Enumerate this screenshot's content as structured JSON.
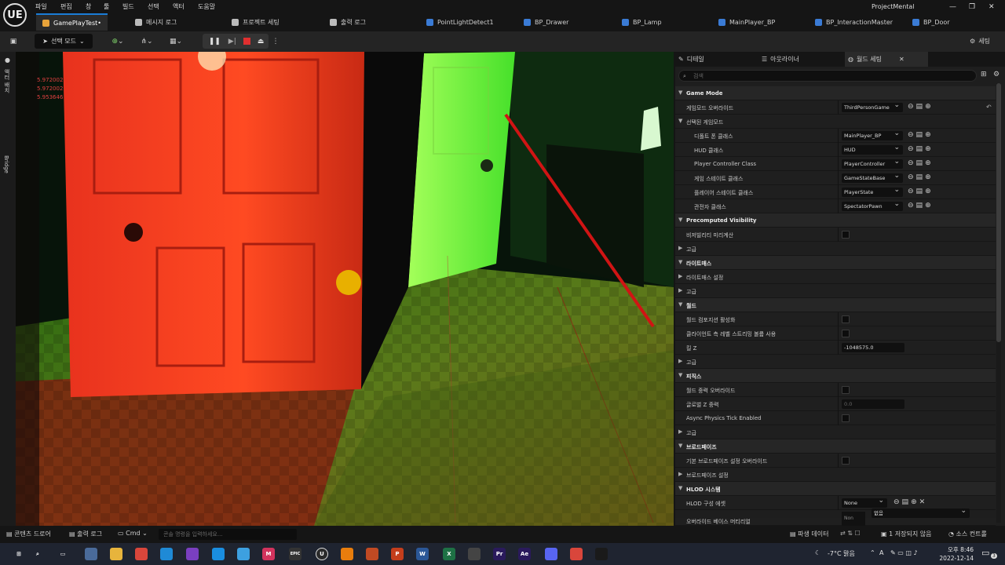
{
  "app": {
    "logo": "UE",
    "project_name": "ProjectMental"
  },
  "menu": [
    "파일",
    "편집",
    "창",
    "툴",
    "빌드",
    "선택",
    "액터",
    "도움말"
  ],
  "window_controls": [
    "—",
    "❐",
    "✕"
  ],
  "tabs": [
    {
      "label": "GamePlayTest•",
      "icon_color": "#e8a33a"
    },
    {
      "label": "메시지 로그",
      "icon_color": "#bbbbbb"
    },
    {
      "label": "프로젝트 세팅",
      "icon_color": "#bbbbbb"
    },
    {
      "label": "출력 로그",
      "icon_color": "#bbbbbb"
    },
    {
      "label": "PointLightDetect1",
      "icon_color": "#3a7bd5"
    },
    {
      "label": "BP_Drawer",
      "icon_color": "#3a7bd5"
    },
    {
      "label": "BP_Lamp",
      "icon_color": "#3a7bd5"
    },
    {
      "label": "MainPlayer_BP",
      "icon_color": "#3a7bd5"
    },
    {
      "label": "BP_InteractionMaster",
      "icon_color": "#3a7bd5"
    },
    {
      "label": "BP_Door",
      "icon_color": "#3a7bd5"
    }
  ],
  "toolbar": {
    "mode_label": "선택 모드",
    "settings_label": "세팅"
  },
  "left_strip": {
    "top_label": "액터 배치",
    "bridge_label": "Bridge"
  },
  "viewport": {
    "stats": [
      "5.972002",
      "5.972002",
      "5.953646"
    ]
  },
  "details": {
    "tabs": [
      "디테일",
      "아웃라이너",
      "월드 세팅"
    ],
    "search_placeholder": "검색",
    "rows": [
      {
        "kind": "section",
        "label": "Game Mode"
      },
      {
        "kind": "prop",
        "label": "게임모드 오버라이드",
        "value": "ThirdPersonGame",
        "control": "dropdown",
        "indent": 0
      },
      {
        "kind": "group",
        "label": "선택된 게임모드"
      },
      {
        "kind": "prop",
        "label": "디폴트 폰 클래스",
        "value": "MainPlayer_BP",
        "control": "dropdown",
        "indent": 1
      },
      {
        "kind": "prop",
        "label": "HUD 클래스",
        "value": "HUD",
        "control": "dropdown",
        "indent": 1
      },
      {
        "kind": "prop",
        "label": "Player Controller Class",
        "value": "PlayerController",
        "control": "dropdown",
        "indent": 1
      },
      {
        "kind": "prop",
        "label": "게임 스테이트 클래스",
        "value": "GameStateBase",
        "control": "dropdown",
        "indent": 1
      },
      {
        "kind": "prop",
        "label": "플레이어 스테이트 클래스",
        "value": "PlayerState",
        "control": "dropdown",
        "indent": 1
      },
      {
        "kind": "prop",
        "label": "관전자 클래스",
        "value": "SpectatorPawn",
        "control": "dropdown",
        "indent": 1
      },
      {
        "kind": "section",
        "label": "Precomputed Visibility"
      },
      {
        "kind": "prop",
        "label": "비저빌리티 미리계산",
        "control": "checkbox",
        "indent": 0
      },
      {
        "kind": "sub",
        "label": "고급"
      },
      {
        "kind": "section",
        "label": "라이트매스"
      },
      {
        "kind": "sub",
        "label": "라이트매스 설정"
      },
      {
        "kind": "sub",
        "label": "고급"
      },
      {
        "kind": "section",
        "label": "월드"
      },
      {
        "kind": "prop",
        "label": "월드 컴포지션 활성화",
        "control": "checkbox",
        "indent": 0
      },
      {
        "kind": "prop",
        "label": "클라이언트 측 레벨 스트리밍 볼륨 사용",
        "control": "checkbox",
        "indent": 0
      },
      {
        "kind": "prop",
        "label": "킬 Z",
        "value": "-1048575.0",
        "control": "number",
        "indent": 0
      },
      {
        "kind": "sub",
        "label": "고급"
      },
      {
        "kind": "section",
        "label": "피직스"
      },
      {
        "kind": "prop",
        "label": "월드 중력 오버라이드",
        "control": "checkbox",
        "indent": 0
      },
      {
        "kind": "prop",
        "label": "글로벌 Z 중력",
        "value": "0.0",
        "control": "number-dim",
        "indent": 0
      },
      {
        "kind": "prop",
        "label": "Async Physics Tick Enabled",
        "control": "checkbox",
        "indent": 0
      },
      {
        "kind": "sub",
        "label": "고급"
      },
      {
        "kind": "section",
        "label": "브로드페이즈"
      },
      {
        "kind": "prop",
        "label": "기본 브로드페이즈 설정 오버라이드",
        "control": "checkbox",
        "indent": 0
      },
      {
        "kind": "sub",
        "label": "브로드페이즈 설정"
      },
      {
        "kind": "section",
        "label": "HLOD 시스템"
      },
      {
        "kind": "prop",
        "label": "HLOD 구성 에셋",
        "value": "None",
        "control": "dropdown-x",
        "indent": 0
      }
    ],
    "partial": {
      "label": "오버라이드 베이스 머티리얼",
      "thumb_label": "Non",
      "value": "없음"
    }
  },
  "statusbar": {
    "content_drawer": "콘텐츠 드로어",
    "output_log": "출력 로그",
    "cmd": "Cmd",
    "cmd_placeholder": "콘솔 명령을 입력하세요...",
    "derived_data": "파생 데이터",
    "unsaved": "1 저장되지 않음",
    "source_control": "소스 컨트롤"
  },
  "taskbar": {
    "apps": [
      {
        "name": "windows-start-icon",
        "color": "#1f2430",
        "glyph": "⊞"
      },
      {
        "name": "search-icon",
        "color": "#1f2430",
        "glyph": "⌕"
      },
      {
        "name": "task-view-icon",
        "color": "#1f2430",
        "glyph": "▭"
      },
      {
        "name": "widgets-icon",
        "color": "#4a6b9a",
        "glyph": ""
      },
      {
        "name": "file-explorer-icon",
        "color": "#e7b43c",
        "glyph": ""
      },
      {
        "name": "chrome-icon",
        "color": "#d9463b",
        "glyph": ""
      },
      {
        "name": "edge-icon",
        "color": "#1f8ad6",
        "glyph": ""
      },
      {
        "name": "visual-studio-icon",
        "color": "#7a3fc0",
        "glyph": ""
      },
      {
        "name": "vscode-icon",
        "color": "#1a8ee0",
        "glyph": ""
      },
      {
        "name": "notepad-icon",
        "color": "#3da0e0",
        "glyph": ""
      },
      {
        "name": "mirosoft-app-icon",
        "color": "#d2335d",
        "glyph": "M"
      },
      {
        "name": "epic-games-icon",
        "color": "#333333",
        "glyph": "EPIC"
      },
      {
        "name": "unreal-editor-icon",
        "color": "#2a2a2a",
        "glyph": "U"
      },
      {
        "name": "blender-icon",
        "color": "#e87d0d",
        "glyph": ""
      },
      {
        "name": "swirl-app-icon",
        "color": "#c14a23",
        "glyph": ""
      },
      {
        "name": "powerpoint-icon",
        "color": "#c43e1c",
        "glyph": "P"
      },
      {
        "name": "word-icon",
        "color": "#2b5797",
        "glyph": "W"
      },
      {
        "name": "excel-icon",
        "color": "#1e7145",
        "glyph": "X"
      },
      {
        "name": "davinci-icon",
        "color": "#444444",
        "glyph": ""
      },
      {
        "name": "premiere-icon",
        "color": "#2a1a5c",
        "glyph": "Pr"
      },
      {
        "name": "after-effects-icon",
        "color": "#2a1a5c",
        "glyph": "Ae"
      },
      {
        "name": "discord-icon",
        "color": "#5865f2",
        "glyph": ""
      },
      {
        "name": "chrome-2-icon",
        "color": "#d9463b",
        "glyph": ""
      },
      {
        "name": "league-icon",
        "color": "#1a1a1a",
        "glyph": ""
      }
    ],
    "weather": "-7°C 맑음",
    "ime": "A",
    "time": "오후 8:46",
    "date": "2022-12-14",
    "notifications": "3"
  }
}
